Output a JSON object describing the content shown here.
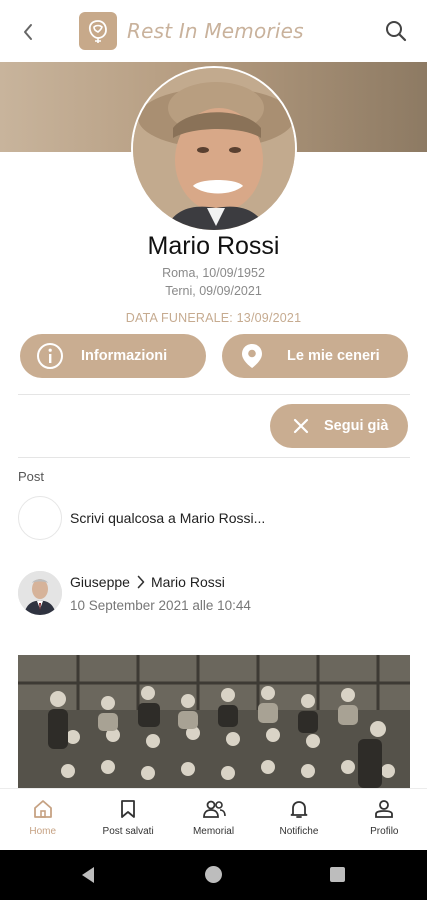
{
  "app": {
    "brand": "Rest In Memories",
    "accent_color": "#c9ad91",
    "back_icon": "chevron-left-icon",
    "search_icon": "search-icon",
    "logo_icon": "rose-logo-icon"
  },
  "profile": {
    "name": "Mario Rossi",
    "born": "Roma, 10/09/1952",
    "died": "Terni, 09/09/2021",
    "funeral": "DATA FUNERALE: 13/09/2021"
  },
  "actions": {
    "info_label": "Informazioni",
    "ashes_label": "Le mie ceneri",
    "follow_label": "Segui già"
  },
  "posts": {
    "section_label": "Post",
    "composer_placeholder": "Scrivi qualcosa a Mario Rossi...",
    "items": [
      {
        "author": "Giuseppe",
        "recipient": "Mario Rossi",
        "date": "10 September 2021 alle 10:44"
      }
    ]
  },
  "nav": {
    "items": [
      {
        "label": "Home",
        "icon": "home-icon",
        "active": true
      },
      {
        "label": "Post salvati",
        "icon": "bookmark-icon",
        "active": false
      },
      {
        "label": "Memorial",
        "icon": "people-icon",
        "active": false
      },
      {
        "label": "Notifiche",
        "icon": "bell-icon",
        "active": false
      },
      {
        "label": "Profilo",
        "icon": "user-icon",
        "active": false
      }
    ]
  }
}
